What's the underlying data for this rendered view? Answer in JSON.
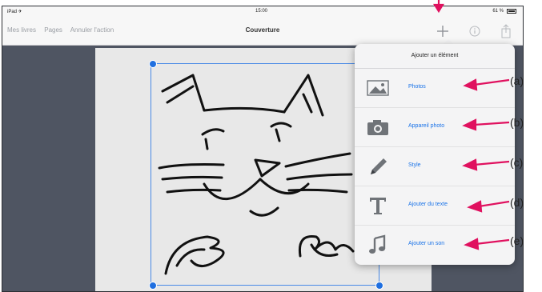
{
  "status_bar": {
    "carrier": "iPad ✈",
    "time": "15:00",
    "battery": "61 %"
  },
  "nav": {
    "left_items": [
      "Mes livres",
      "Pages",
      "Annuler l'action"
    ],
    "title": "Couverture",
    "add_icon": "plus-icon",
    "info_icon": "info-icon",
    "share_icon": "share-icon"
  },
  "popover": {
    "title": "Ajouter un élément",
    "items": [
      {
        "label": "Photos",
        "icon": "photo-icon"
      },
      {
        "label": "Appareil photo",
        "icon": "camera-icon"
      },
      {
        "label": "Style",
        "icon": "pencil-icon"
      },
      {
        "label": "Ajouter du texte",
        "icon": "text-icon"
      },
      {
        "label": "Ajouter un son",
        "icon": "music-note-icon"
      }
    ]
  },
  "callouts": [
    "(a)",
    "(b)",
    "(c)",
    "(d)",
    "(e)"
  ],
  "colors": {
    "accent": "#1a73e8",
    "arrow": "#e0115f",
    "toolbar_bg": "#f7f7f7",
    "backdrop": "#4f5562"
  }
}
